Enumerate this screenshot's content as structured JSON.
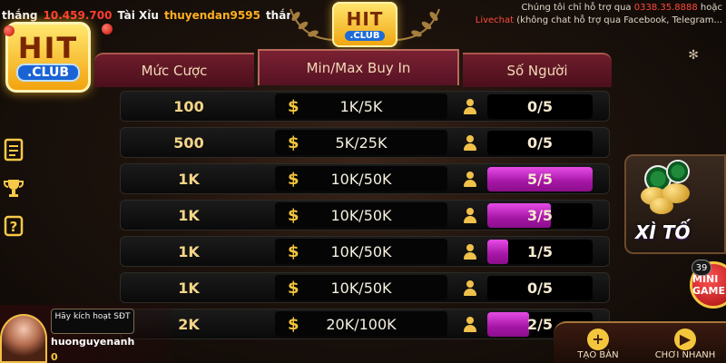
{
  "ticker": {
    "prefix": "thắng",
    "amount": "10.459.700",
    "game": "Tài Xỉu",
    "user": "thuyendan9595",
    "suffix": "thắng"
  },
  "top_logo": {
    "hit": "HIT",
    "club": ".CLUB"
  },
  "left_logo": {
    "hit": "HIT",
    "club": ".CLUB"
  },
  "support": {
    "line1_prefix": "Chúng tôi chỉ hỗ trợ qua",
    "phone": "0338.35.8888",
    "line1_suffix": "hoặc",
    "live": "Livechat",
    "line2": "(không chat hỗ trợ qua Facebook, Telegram..."
  },
  "side_menu": [
    {
      "name": "document-icon",
      "glyph": "☰"
    },
    {
      "name": "trophy-icon",
      "glyph": "🏆"
    },
    {
      "name": "help-icon",
      "glyph": "?"
    }
  ],
  "header": {
    "bet": "Mức Cược",
    "buyin": "Min/Max Buy In",
    "players": "Số Người"
  },
  "rows": [
    {
      "bet": "100",
      "buyin": "1K/5K",
      "players": "0/5",
      "fill": 0.0
    },
    {
      "bet": "500",
      "buyin": "5K/25K",
      "players": "0/5",
      "fill": 0.0
    },
    {
      "bet": "1K",
      "buyin": "10K/50K",
      "players": "5/5",
      "fill": 1.0
    },
    {
      "bet": "1K",
      "buyin": "10K/50K",
      "players": "3/5",
      "fill": 0.6
    },
    {
      "bet": "1K",
      "buyin": "10K/50K",
      "players": "1/5",
      "fill": 0.2
    },
    {
      "bet": "1K",
      "buyin": "10K/50K",
      "players": "0/5",
      "fill": 0.0
    },
    {
      "bet": "2K",
      "buyin": "20K/100K",
      "players": "2/5",
      "fill": 0.4
    }
  ],
  "promo": {
    "title": "XÌ TỐ"
  },
  "mini": {
    "label": "MINI GAME",
    "badge": "39"
  },
  "user": {
    "activate": "Hãy kích hoạt SĐT",
    "name": "huonguyenanh",
    "balance": "0"
  },
  "bottom": {
    "create": "TẠO BÀN",
    "play": "CHƠI NHANH"
  },
  "colors": {
    "accent_gold": "#f4c63c",
    "fill_magenta": "#c02ec0",
    "header_red": "#6e1c2a"
  }
}
